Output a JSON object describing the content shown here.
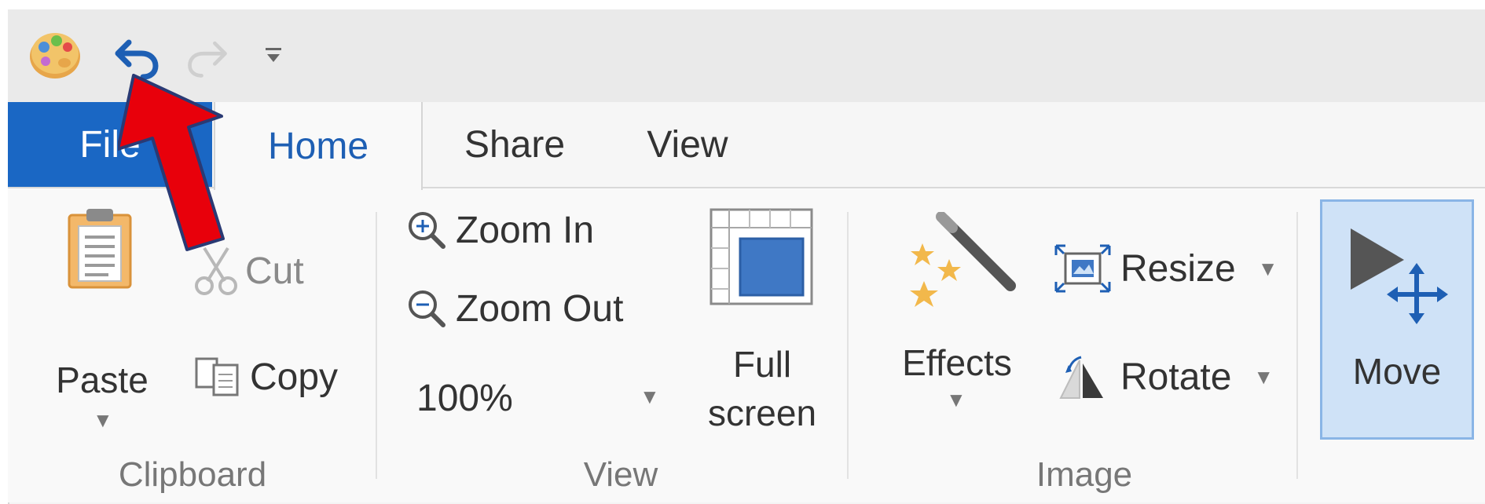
{
  "window": {
    "app_icon": "paint-palette-icon",
    "qat": {
      "undo_icon": "undo-icon",
      "redo_icon": "redo-icon",
      "customize_icon": "customize-qat-icon"
    }
  },
  "tabs": [
    {
      "label": "File"
    },
    {
      "label": "Home"
    },
    {
      "label": "Share"
    },
    {
      "label": "View"
    }
  ],
  "ribbon": {
    "clipboard": {
      "paste_label": "Paste",
      "cut_label": "Cut",
      "copy_label": "Copy",
      "group_label": "Clipboard"
    },
    "view": {
      "zoom_in_label": "Zoom In",
      "zoom_out_label": "Zoom Out",
      "zoom_value": "100%",
      "full_screen_line1": "Full",
      "full_screen_line2": "screen",
      "group_label": "View"
    },
    "image": {
      "effects_label": "Effects",
      "resize_label": "Resize",
      "rotate_label": "Rotate",
      "group_label": "Image"
    },
    "move": {
      "move_label": "Move"
    }
  },
  "colors": {
    "file_tab": "#1a67c4",
    "home_tab_text": "#1e5fb4",
    "move_selected": "#cfe2f7",
    "annotation_arrow": "#e8000b"
  }
}
